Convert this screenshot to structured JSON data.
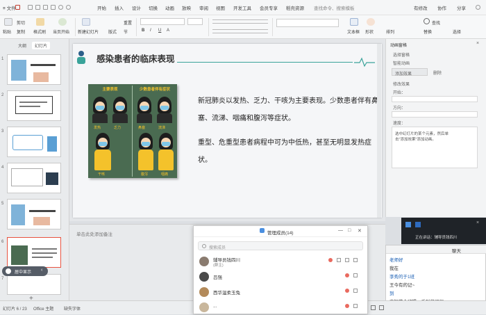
{
  "menubar": {
    "items": [
      {
        "label": "≡ 文件"
      },
      {
        "label": "开始",
        "active": true
      },
      {
        "label": "插入"
      },
      {
        "label": "设计"
      },
      {
        "label": "切换"
      },
      {
        "label": "动画"
      },
      {
        "label": "放映"
      },
      {
        "label": "审阅"
      },
      {
        "label": "视图"
      },
      {
        "label": "开发工具"
      },
      {
        "label": "会员专享"
      },
      {
        "label": "稻壳资源"
      }
    ],
    "search_placeholder": "查找命令、搜索模板",
    "right_items": [
      "有修改",
      "协作",
      "分享"
    ]
  },
  "ribbon": {
    "labels": [
      "粘贴",
      "剪切",
      "复制",
      "格式刷",
      "当页开始",
      "新建幻灯片",
      "版式",
      "节",
      "重置",
      "文本框",
      "形状",
      "排列",
      "查找",
      "替换",
      "选择"
    ]
  },
  "leftpane": {
    "tabs": [
      "大纲",
      "幻灯片"
    ],
    "slide_numbers": [
      "1",
      "2",
      "3",
      "4",
      "5",
      "6",
      "7"
    ]
  },
  "slide": {
    "title": "感染患者的临床表现",
    "panel_left_header": "主要表现",
    "panel_right_header": "少数患者伴有症状",
    "fig_labels": [
      "发热",
      "乏力",
      "干咳",
      "鼻塞",
      "流涕",
      "咽痛",
      "腹泻",
      "低热",
      "发热"
    ],
    "paragraph1": "新冠肺炎以发热、乏力、干咳为主要表现。少数患者伴有鼻塞、流涕、咽痛和腹泻等症状。",
    "paragraph2": "重型、危重型患者病程中可为中低热，甚至无明显发热症状。"
  },
  "notes": {
    "placeholder": "单击此处添加备注"
  },
  "rightpane": {
    "title": "动画窗格",
    "lines": [
      "选择窗格",
      "智能动画",
      "添加效果",
      "删除",
      "修改效果",
      "开始：",
      "方向：",
      "速度："
    ],
    "hint": "选中幻灯片的某个元素，然后单击\"添加效果\"添加动画。"
  },
  "statusbar": {
    "slide_count": "幻灯片 6 / 23",
    "theme": "Office 主题",
    "font_missing": "缺失字体",
    "zoom": "46%"
  },
  "chatwin": {
    "title": "管理成员(14)",
    "search_placeholder": "搜索成员",
    "members": [
      {
        "name": "辅导员钱四川",
        "sub": "(群主)"
      },
      {
        "name": "吕强",
        "sub": ""
      },
      {
        "name": "西华温柔玉兔",
        "sub": ""
      },
      {
        "name": "...",
        "sub": ""
      }
    ],
    "buttons": [
      "—",
      "□",
      "✕"
    ]
  },
  "darkbar": {
    "text": "正在讲话：辅导员钱四川"
  },
  "chatpanel": {
    "title": "聊天",
    "messages": [
      {
        "text": "老师好",
        "color": "#1a5fb4"
      },
      {
        "text": "我在",
        "color": "#333"
      },
      {
        "text": "李秀的于1班",
        "color": "#1a5fb4"
      },
      {
        "text": "王今有的记~",
        "color": "#333"
      },
      {
        "text": "到",
        "color": "#1a5fb4"
      },
      {
        "text": "康智芯全班提一系列的课程",
        "color": "#333"
      },
      {
        "text": "收到",
        "color": "#1a5fb4"
      }
    ]
  },
  "floatbtn": {
    "label": "居中显示"
  },
  "colors": {
    "accent": "#e8523f",
    "slide_panel_green": "#4a6b51",
    "title_teal": "#3aa39a",
    "figure_yellow": "#f4c22b"
  }
}
